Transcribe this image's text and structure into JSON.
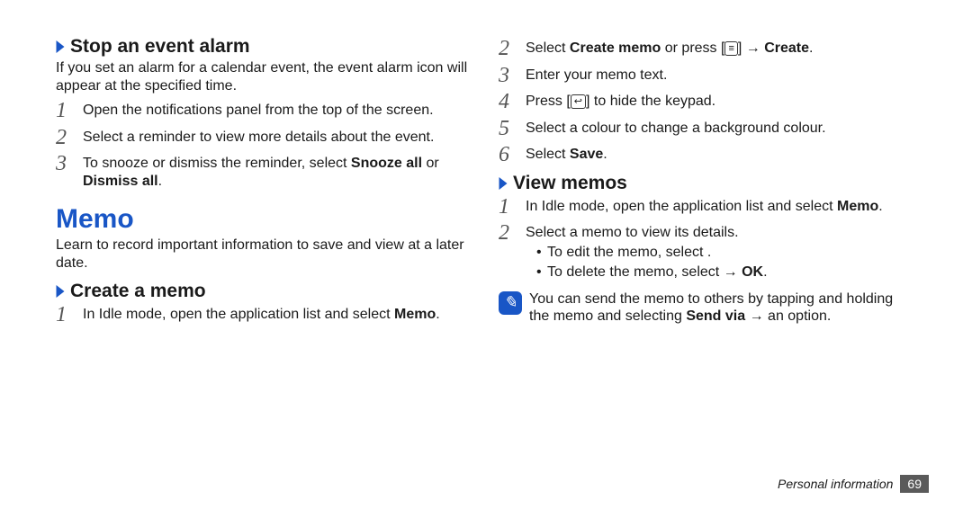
{
  "left": {
    "section1": {
      "title": "Stop an event alarm",
      "intro": "If you set an alarm for a calendar event, the event alarm icon will appear at the specified time.",
      "steps": [
        "Open the notifications panel from the top of the screen.",
        "Select a reminder to view more details about the event."
      ],
      "step3_pre": "To snooze or dismiss the reminder, select ",
      "step3_b1": "Snooze all",
      "step3_mid": " or ",
      "step3_b2": "Dismiss all",
      "step3_post": "."
    },
    "feature": {
      "title": "Memo",
      "desc": "Learn to record important information to save and view at a later date."
    },
    "section2": {
      "title": "Create a memo",
      "step1_pre": "In Idle mode, open the application list and select ",
      "step1_b": "Memo",
      "step1_post": "."
    }
  },
  "right": {
    "createCont": {
      "step2_pre": "Select ",
      "step2_b1": "Create memo",
      "step2_mid1": " or press [",
      "step2_icon": "≡",
      "step2_mid2": "] ",
      "step2_arrow": "→",
      "step2_mid3": " ",
      "step2_b2": "Create",
      "step2_post": ".",
      "step3": "Enter your memo text.",
      "step4_pre": "Press [",
      "step4_icon": "↩",
      "step4_post": "] to hide the keypad.",
      "step5": "Select a colour to change a background colour.",
      "step6_pre": "Select ",
      "step6_b": "Save",
      "step6_post": "."
    },
    "view": {
      "title": "View memos",
      "step1_pre": "In Idle mode, open the application list and select ",
      "step1_b": "Memo",
      "step1_post": ".",
      "step2": "Select a memo to view its details.",
      "bullet1": "To edit the memo, select       .",
      "bullet2_pre": "To delete the memo, select       ",
      "bullet2_arrow": "→",
      "bullet2_mid": " ",
      "bullet2_b": "OK",
      "bullet2_post": ".",
      "note_pre": "You can send the memo to others by tapping and holding the memo and selecting ",
      "note_b": "Send via",
      "note_mid": " ",
      "note_arrow": "→",
      "note_post": " an option."
    }
  },
  "footer": {
    "section": "Personal information",
    "page": "69"
  }
}
